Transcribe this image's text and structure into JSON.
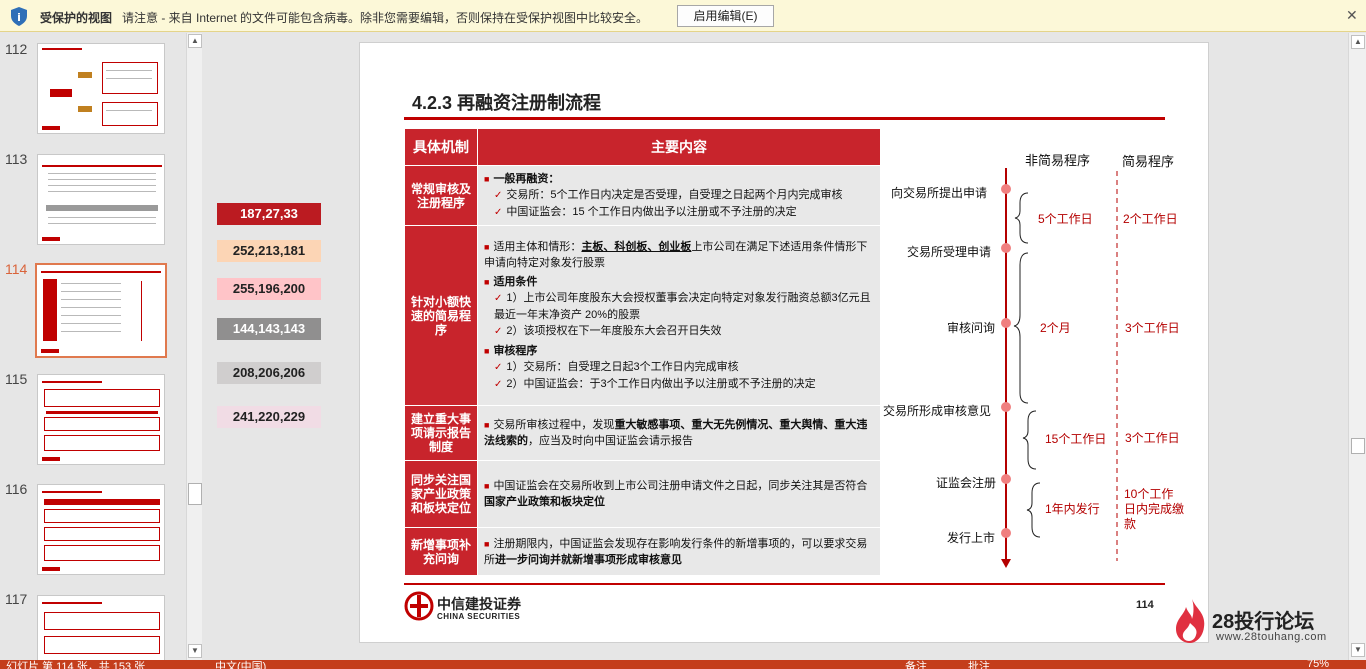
{
  "protected_view": {
    "title": "受保护的视图",
    "message": "请注意 - 来自 Internet 的文件可能包含病毒。除非您需要编辑，否则保持在受保护视图中比较安全。",
    "enable_button": "启用编辑(E)",
    "close_glyph": "✕"
  },
  "thumbnails": [
    {
      "num": "112",
      "active": false
    },
    {
      "num": "113",
      "active": false
    },
    {
      "num": "114",
      "active": true
    },
    {
      "num": "115",
      "active": false
    },
    {
      "num": "116",
      "active": false
    },
    {
      "num": "117",
      "active": false
    }
  ],
  "color_codes": [
    {
      "label": "187,27,33",
      "bg": "#bb1b21",
      "fg": "#ffffff"
    },
    {
      "label": "252,213,181",
      "bg": "#fcd5b5",
      "fg": "#222222"
    },
    {
      "label": "255,196,200",
      "bg": "#ffc4c8",
      "fg": "#222222"
    },
    {
      "label": "144,143,143",
      "bg": "#908f8f",
      "fg": "#ffffff"
    },
    {
      "label": "208,206,206",
      "bg": "#d0cece",
      "fg": "#222222"
    },
    {
      "label": "241,220,229",
      "bg": "#f1dce5",
      "fg": "#222222"
    }
  ],
  "slide": {
    "title": "4.2.3  再融资注册制流程",
    "table": {
      "header_mech": "具体机制",
      "header_content": "主要内容",
      "rows": {
        "r1_mech": "常规审核及注册程序",
        "r1_b1": "一般再融资：",
        "r1_c1": "交易所：5个工作日内决定是否受理，自受理之日起两个月内完成审核",
        "r1_c2": "中国证监会：15 个工作日内做出予以注册或不予注册的决定",
        "r2_mech": "针对小额快速的简易程序",
        "r2_b1_pre": "适用主体和情形：",
        "r2_b1_u": "主板、科创板、创业板",
        "r2_b1_post": "上市公司在满足下述适用条件情形下申请向特定对象发行股票",
        "r2_b2": "适用条件",
        "r2_c1": "1）上市公司年度股东大会授权董事会决定向特定对象发行融资总额3亿元且最近一年末净资产 20%的股票",
        "r2_c2": "2）该项授权在下一年度股东大会召开日失效",
        "r2_b3": "审核程序",
        "r2_c3": "1）交易所：自受理之日起3个工作日内完成审核",
        "r2_c4": "2）中国证监会：于3个工作日内做出予以注册或不予注册的决定",
        "r3_mech": "建立重大事项请示报告制度",
        "r3_pre": "交易所审核过程中，发现",
        "r3_bold": "重大敏感事项、重大无先例情况、重大舆情、重大违法线索的",
        "r3_post": "，应当及时向中国证监会请示报告",
        "r4_mech": "同步关注国家产业政策和板块定位",
        "r4_pre": "中国证监会在交易所收到上市公司注册申请文件之日起，同步关注其是否符合",
        "r4_bold": "国家产业政策和板块定位",
        "r5_mech": "新增事项补充问询",
        "r5_pre": "注册期限内，中国证监会发现存在影响发行条件的新增事项的，可以要求交易所",
        "r5_bold": "进一步问询并就新增事项形成审核意见"
      }
    },
    "timeline": {
      "head_left": "非简易程序",
      "head_right": "简易程序",
      "steps": [
        "向交易所提出申请",
        "交易所受理申请",
        "审核问询",
        "交易所形成审核意见",
        "证监会注册",
        "发行上市"
      ],
      "left_durations": [
        "5个工作日",
        "2个月",
        "15个工作日",
        "1年内发行"
      ],
      "right_durations": [
        "2个工作日",
        "3个工作日",
        "3个工作日",
        "10个工作日内完成缴款"
      ]
    },
    "logo_cn": "中信建投证券",
    "logo_en": "CHINA SECURITIES",
    "page_number": "114"
  },
  "watermark": {
    "site": "28投行论坛",
    "url": "www.28touhang.com"
  },
  "statusbar": {
    "slide_info": "幻灯片 第 114 张，共 153 张",
    "language": "中文(中国)",
    "notes": "备注",
    "comments": "批注",
    "zoom": "75%"
  }
}
